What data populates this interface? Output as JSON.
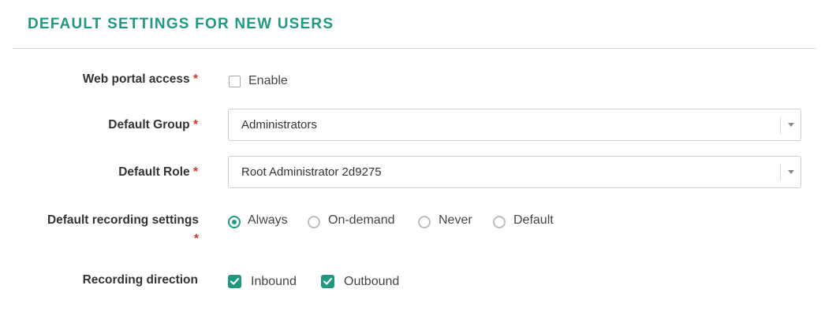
{
  "section": {
    "title": "DEFAULT SETTINGS FOR NEW USERS"
  },
  "required_mark": "*",
  "web_portal": {
    "label": "Web portal access",
    "checkbox_label": "Enable",
    "checked": false
  },
  "default_group": {
    "label": "Default Group",
    "value": "Administrators"
  },
  "default_role": {
    "label": "Default Role",
    "value": "Root Administrator 2d9275"
  },
  "recording_settings": {
    "label": "Default recording settings",
    "options": [
      "Always",
      "On-demand",
      "Never",
      "Default"
    ],
    "selected": "Always"
  },
  "recording_direction": {
    "label": "Recording direction",
    "options": [
      "Inbound",
      "Outbound"
    ],
    "checked": [
      "Inbound",
      "Outbound"
    ]
  },
  "colors": {
    "accent": "#1f9a80",
    "required": "#d9342b"
  }
}
